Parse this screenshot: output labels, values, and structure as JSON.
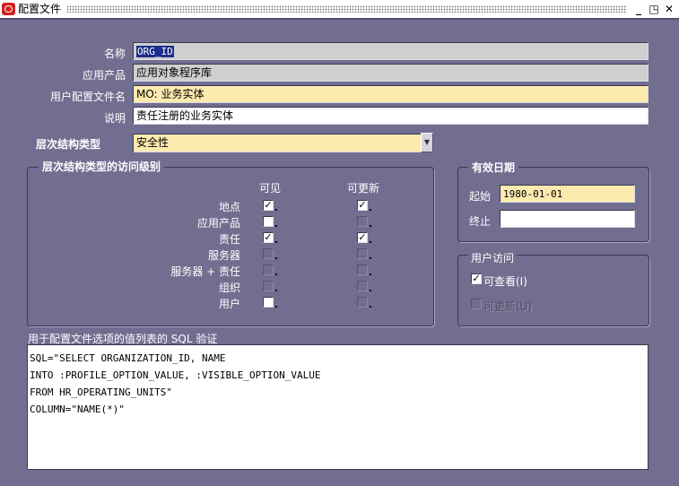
{
  "window": {
    "title": "配置文件"
  },
  "form": {
    "name": {
      "label": "名称",
      "value": "ORG_ID"
    },
    "application": {
      "label": "应用产品",
      "value": "应用对象程序库"
    },
    "user_profile_name": {
      "label": "用户配置文件名",
      "value": "MO: 业务实体"
    },
    "description": {
      "label": "说明",
      "value": "责任注册的业务实体"
    },
    "hierarchy_type": {
      "label": "层次结构类型",
      "value": "安全性"
    }
  },
  "access_levels": {
    "title": "层次结构类型的访问级别",
    "col_visible": "可见",
    "col_updatable": "可更新",
    "rows": [
      {
        "label": "地点",
        "visible": true,
        "updatable": true,
        "visible_enabled": true,
        "updatable_enabled": true
      },
      {
        "label": "应用产品",
        "visible": false,
        "updatable": false,
        "visible_enabled": true,
        "updatable_enabled": false
      },
      {
        "label": "责任",
        "visible": true,
        "updatable": true,
        "visible_enabled": true,
        "updatable_enabled": true
      },
      {
        "label": "服务器",
        "visible": false,
        "updatable": false,
        "visible_enabled": false,
        "updatable_enabled": false
      },
      {
        "label": "服务器 + 责任",
        "visible": false,
        "updatable": false,
        "visible_enabled": false,
        "updatable_enabled": false
      },
      {
        "label": "组织",
        "visible": false,
        "updatable": false,
        "visible_enabled": false,
        "updatable_enabled": false
      },
      {
        "label": "用户",
        "visible": false,
        "updatable": false,
        "visible_enabled": true,
        "updatable_enabled": false
      }
    ]
  },
  "effective_dates": {
    "title": "有效日期",
    "start_label": "起始",
    "start_value": "1980-01-01",
    "end_label": "终止",
    "end_value": ""
  },
  "user_access": {
    "title": "用户访问",
    "can_view": {
      "label": "可查看(I)",
      "checked": true
    },
    "can_update": {
      "label": "可更新(U)",
      "checked": false
    }
  },
  "sql": {
    "label": "用于配置文件选项的值列表的 SQL 验证",
    "value": "SQL=\"SELECT ORGANIZATION_ID, NAME\nINTO :PROFILE_OPTION_VALUE, :VISIBLE_OPTION_VALUE\nFROM HR_OPERATING_UNITS\"\nCOLUMN=\"NAME(*)\""
  },
  "icons": {
    "app": "oracle-icon",
    "minimize": "minimize-icon",
    "maximize": "maximize-icon",
    "close": "close-icon"
  }
}
